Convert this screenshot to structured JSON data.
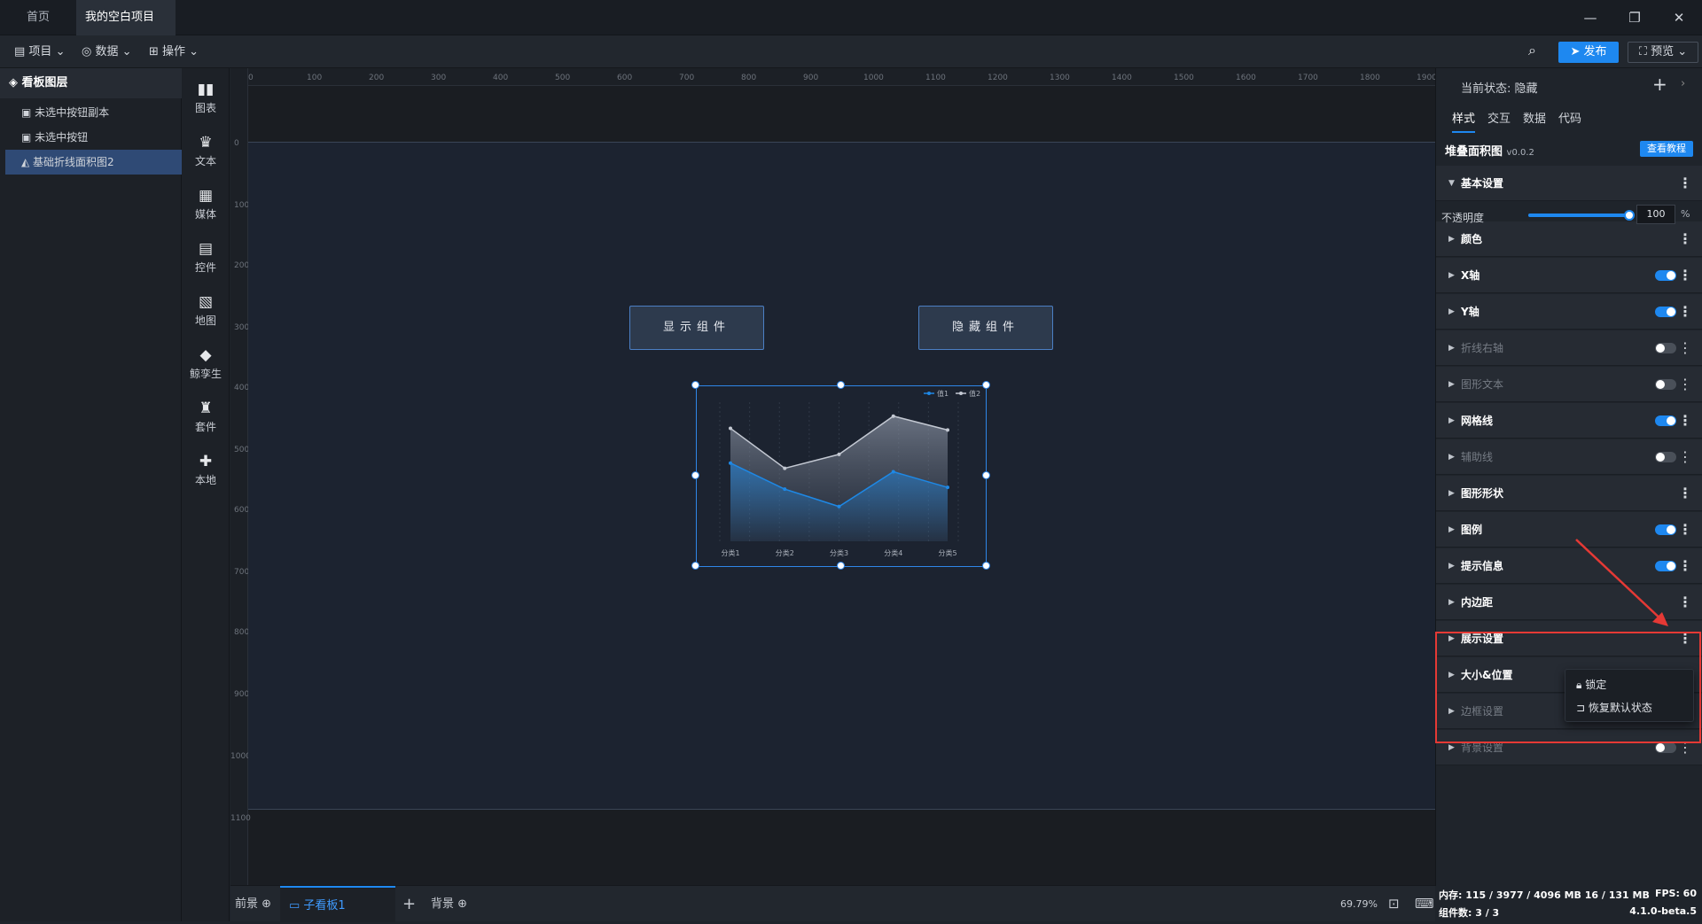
{
  "tabs": [
    {
      "label": "首页"
    },
    {
      "label": "我的空白项目"
    }
  ],
  "menu": {
    "project": "项目",
    "data": "数据",
    "ops": "操作"
  },
  "toolbar": {
    "publish": "发布",
    "preview": "预览"
  },
  "layers": {
    "title": "看板图层",
    "items": [
      "未选中按钮副本",
      "未选中按钮",
      "基础折线面积图2"
    ]
  },
  "components": [
    "图表",
    "文本",
    "媒体",
    "控件",
    "地图",
    "鲸孪生",
    "套件",
    "本地"
  ],
  "ruler": {
    "h": [
      "0",
      "100",
      "200",
      "300",
      "400",
      "500",
      "600",
      "700",
      "800",
      "900",
      "1000",
      "1100",
      "1200",
      "1300",
      "1400",
      "1500",
      "1600",
      "1700",
      "1800",
      "1900"
    ],
    "v": [
      "0",
      "100",
      "200",
      "300",
      "400",
      "500",
      "600",
      "700",
      "800",
      "900",
      "1000",
      "1100"
    ]
  },
  "canvas": {
    "btn_show": "显示组件",
    "btn_hide": "隐藏组件"
  },
  "chart_data": {
    "type": "area",
    "categories": [
      "分类1",
      "分类2",
      "分类3",
      "分类4",
      "分类5"
    ],
    "series": [
      {
        "name": "值1",
        "values": [
          45,
          30,
          20,
          40,
          31
        ]
      },
      {
        "name": "值2",
        "values": [
          65,
          42,
          50,
          72,
          64
        ]
      }
    ],
    "ylim": [
      0,
      80
    ],
    "legend": "top-right",
    "colors": [
      "#1e88e5",
      "#8a93a3"
    ]
  },
  "bottom": {
    "front": "前景",
    "board": "子看板1",
    "bg": "背景",
    "zoom": "69.79%"
  },
  "panel": {
    "state_label": "当前状态:",
    "state_value": "隐藏",
    "tabs": [
      "样式",
      "交互",
      "数据",
      "代码"
    ],
    "comp_name": "堆叠面积图",
    "version": "v0.0.2",
    "tutorial": "查看教程",
    "opacity_label": "不透明度",
    "opacity_value": "100",
    "opacity_unit": "%",
    "opacity_level": 1.0,
    "sections": [
      {
        "label": "基本设置",
        "open": true,
        "toggle": null,
        "dim": false
      },
      {
        "label": "颜色",
        "toggle": null,
        "dim": false
      },
      {
        "label": "X轴",
        "toggle": true,
        "dim": false
      },
      {
        "label": "Y轴",
        "toggle": true,
        "dim": false
      },
      {
        "label": "折线右轴",
        "toggle": false,
        "dim": true
      },
      {
        "label": "图形文本",
        "toggle": false,
        "dim": true
      },
      {
        "label": "网格线",
        "toggle": true,
        "dim": false
      },
      {
        "label": "辅助线",
        "toggle": false,
        "dim": true
      },
      {
        "label": "图形形状",
        "toggle": null,
        "dim": false
      },
      {
        "label": "图例",
        "toggle": true,
        "dim": false
      },
      {
        "label": "提示信息",
        "toggle": true,
        "dim": false
      },
      {
        "label": "内边距",
        "toggle": null,
        "dim": false
      },
      {
        "label": "展示设置",
        "toggle": null,
        "dim": false
      },
      {
        "label": "大小&位置",
        "toggle": null,
        "dim": false
      },
      {
        "label": "边框设置",
        "toggle": null,
        "dim": true
      },
      {
        "label": "背景设置",
        "toggle": false,
        "dim": true
      }
    ],
    "context_menu": [
      "锁定",
      "恢复默认状态"
    ]
  },
  "status": {
    "mem": "内存:  115 / 3977 / 4096 MB  16 / 131 MB",
    "fps": "FPS:  60",
    "count": "组件数: 3 / 3",
    "ver": "4.1.0-beta.5"
  }
}
